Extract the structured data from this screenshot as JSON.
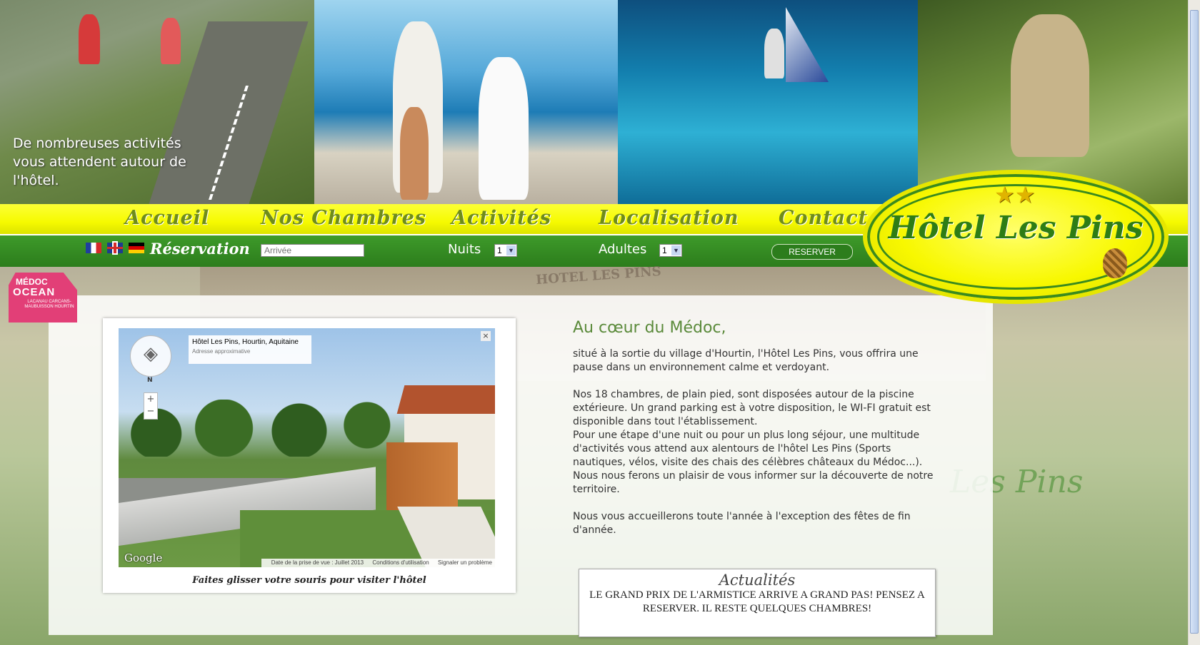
{
  "banner": {
    "caption": "De nombreuses activités vous attendent autour de l'hôtel."
  },
  "nav": {
    "items": [
      "Accueil",
      "Nos Chambres",
      "Activités",
      "Localisation",
      "Contact"
    ]
  },
  "logo": {
    "title": "Hôtel Les Pins",
    "stars": "★★"
  },
  "reservation": {
    "title": "Réservation",
    "arrival_placeholder": "Arrivée",
    "nights_label": "Nuits",
    "nights_value": "1",
    "adults_label": "Adultes",
    "adults_value": "1",
    "button": "RESERVER"
  },
  "medoc": {
    "line1": "MÉDOC",
    "line2": "OCEAN",
    "line3": "LACANAU CARCANS-MAUBUISSON HOURTIN"
  },
  "streetview": {
    "place": "Hôtel Les Pins, Hourtin, Aquitaine",
    "sub": "Adresse approximative",
    "close": "×",
    "north": "N",
    "zoom_in": "+",
    "zoom_out": "−",
    "google": "Google",
    "date": "Date de la prise de vue : Juillet 2013",
    "terms": "Conditions d'utilisation",
    "report": "Signaler un problème",
    "caption": "Faites glisser votre souris pour visiter l'hôtel"
  },
  "content": {
    "title": "Au cœur du Médoc,",
    "p1": "situé à la sortie du village d'Hourtin, l'Hôtel Les Pins, vous offrira une pause dans un environnement calme et verdoyant.",
    "p2": "Nos 18 chambres, de plain pied, sont disposées autour de la piscine extérieure. Un grand parking est à votre disposition, le WI-FI gratuit est disponible dans tout l'établissement.",
    "p3": "Pour une étape d'une nuit ou pour un plus long séjour, une multitude d'activités vous attend aux alentours de l'hôtel Les Pins (Sports nautiques, vélos, visite des chais des célèbres châteaux du Médoc...).",
    "p4": "Nous nous ferons un plaisir de vous informer sur la découverte de notre territoire.",
    "p5": "Nous vous accueillerons toute l'année à l'exception des fêtes de fin d'année."
  },
  "news": {
    "title": "Actualités",
    "body": "LE GRAND PRIX DE L'ARMISTICE ARRIVE A GRAND PAS! PENSEZ A RESERVER. IL RESTE QUELQUES CHAMBRES!"
  },
  "background": {
    "sign": "HOTEL LES PINS",
    "sign2": "Les Pins"
  },
  "colors": {
    "nav_yellow": "#f6fa00",
    "bar_green": "#2c7d1c",
    "title_green": "#5a8a3a",
    "medoc_pink": "#e23f77"
  }
}
